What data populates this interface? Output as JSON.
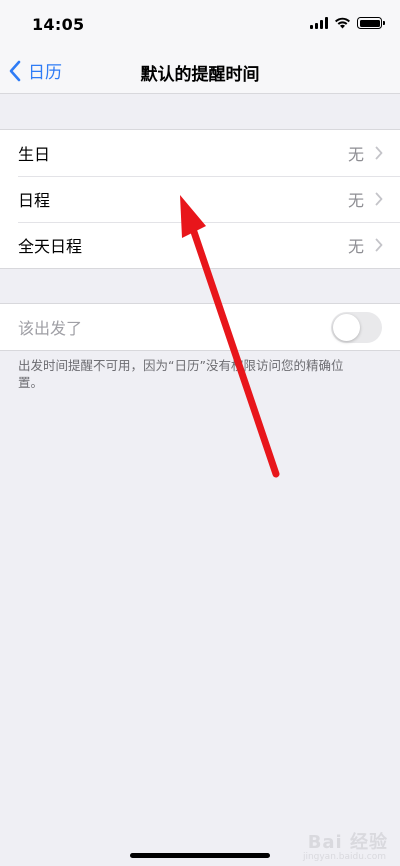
{
  "status_bar": {
    "time": "14:05"
  },
  "nav": {
    "back_label": "日历",
    "title": "默认的提醒时间"
  },
  "reminders": [
    {
      "label": "生日",
      "value": "无"
    },
    {
      "label": "日程",
      "value": "无"
    },
    {
      "label": "全天日程",
      "value": "无"
    }
  ],
  "leave_alert": {
    "label": "该出发了",
    "enabled": false
  },
  "footnote": "出发时间提醒不可用，因为“日历”没有权限访问您的精确位置。",
  "watermark": {
    "text": "Bai 经验",
    "sub": "jingyan.baidu.com"
  },
  "colors": {
    "accent": "#2f7cf6",
    "annotation_arrow": "#e8161b"
  }
}
